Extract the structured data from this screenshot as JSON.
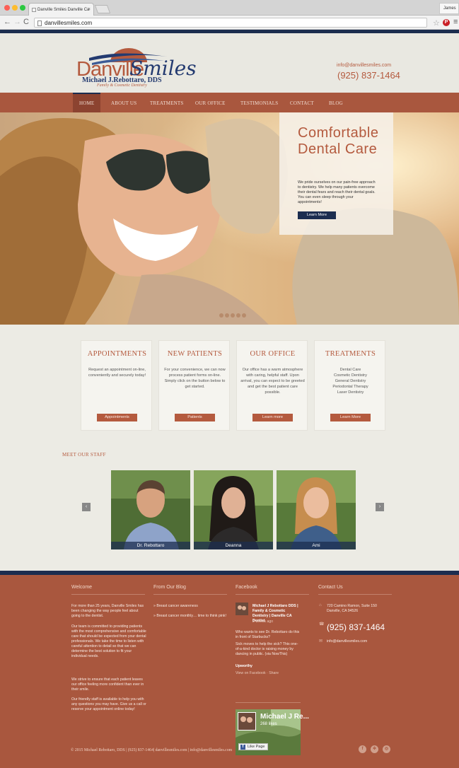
{
  "browser": {
    "tab_title": "Danville Smiles Danville Ca",
    "tab_close": "×",
    "profile": "James",
    "url": "danvillesmiles.com"
  },
  "header": {
    "logo_word1": "Danville",
    "logo_word2": "Smiles",
    "logo_name": "Michael J.Rebottaro, DDS",
    "logo_sub": "Family & Cosmetic Dentistry",
    "email": "info@danvillesmiles.com",
    "phone": "(925) 837-1464"
  },
  "nav": [
    {
      "label": "HOME"
    },
    {
      "label": "ABOUT US"
    },
    {
      "label": "TREATMENTS"
    },
    {
      "label": "OUR OFFICE"
    },
    {
      "label": "TESTIMONIALS"
    },
    {
      "label": "CONTACT"
    },
    {
      "label": "BLOG"
    }
  ],
  "hero": {
    "title": "Comfortable Dental Care",
    "text": "We pride ourselves on our pain-free approach to dentistry. We help many patients overcome their dental fears and reach their dental goals. You can even sleep through your appointments!",
    "button": "Learn More"
  },
  "cards": [
    {
      "title": "APPOINTMENTS",
      "text": "Request an appointment on-line, conveniently and securely today!",
      "button": "Appointments"
    },
    {
      "title": "NEW PATIENTS",
      "text": "For your convenience, we can now process patient forms on-line. Simply click on the button below to get started.",
      "button": "Patients"
    },
    {
      "title": "OUR OFFICE",
      "text": "Our office has a warm atmosphere with caring, helpful staff. Upon arrival, you can expect to be greeted and get the best patient care possible.",
      "button": "Learn more"
    },
    {
      "title": "TREATMENTS",
      "text": "Dental Care\nCosmetic Dentistry\nGeneral Dentistry\nPeriodontal Therapy\nLaser Dentistry",
      "button": "Learn More"
    }
  ],
  "staff": {
    "heading": "MEET OUR STAFF",
    "prev": "‹",
    "next": "›",
    "members": [
      {
        "name": "Dr. Rebottaro"
      },
      {
        "name": "Deanna"
      },
      {
        "name": "Ami"
      }
    ]
  },
  "footer": {
    "welcome": {
      "heading": "Welcome",
      "p1": "For more than 25 years, Danville Smiles has been changing the way people feel about going to the dentist.",
      "p2": "Our team is committed to providing patients with the most comprehensive and comfortable care that should be expected from your dental professionals. We take the time to listen with careful attention to detail so that we can determine the best solution to fit your individual needs.",
      "p3": "We strive to ensure that each patient leaves our office feeling more confident than ever in their smile.",
      "p4": "Our friendly staff is available to help you with any questions you may have. Give us a call or reserve your appointment online today!"
    },
    "blog": {
      "heading": "From Our Blog",
      "posts": [
        "» Breast cancer awareness",
        "» Breast cancer monthly… time to think pink!"
      ]
    },
    "facebook": {
      "heading": "Facebook",
      "page_title": "Michael J Rebottaro DDS | Family & Cosmetic Dentistry | Danville CA Dentist",
      "time": "2 weeks ago",
      "post1": "Who wants to see Dr. Rebottaro do this in front of Starbucks?",
      "post2": "Sick moves to help the sick? This one-of-a-kind doctor is raising money by dancing in public. (via NowThis)",
      "source": "Upworthy",
      "actions": "View on Facebook · Share",
      "widget_name": "Michael J Re...",
      "widget_likes": "268 likes",
      "like_button": "Like Page"
    },
    "contact": {
      "heading": "Contact Us",
      "address": "720 Camino Ramon, Suite 150\nDanville, CA 94526",
      "phone": "(925) 837-1464",
      "email": "info@danvillesmiles.com"
    },
    "copyright": "© 2015 Michael Rebottaro, DDS | (925) 837-1464| danvillesmiles.com | info@danvillesmiles.com",
    "social": [
      "f",
      "✲",
      "◎"
    ]
  },
  "colors": {
    "brand_rust": "#a9573e",
    "brand_navy": "#1c2d4f",
    "cream": "#efeeea"
  }
}
